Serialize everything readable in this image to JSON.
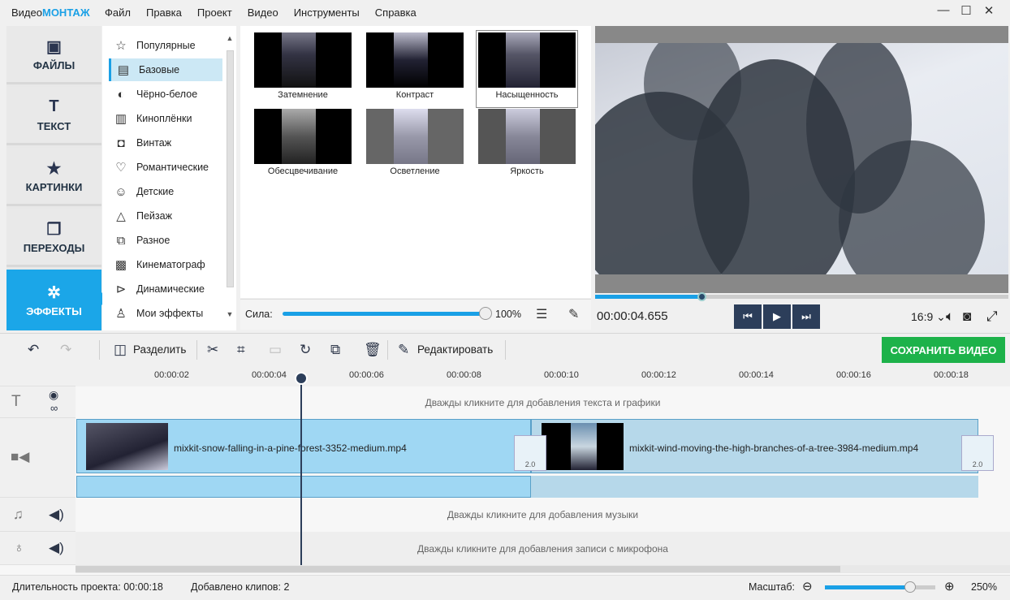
{
  "app": {
    "title_prefix": "Видео",
    "title_brand": "МОНТАЖ"
  },
  "menu": [
    "Файл",
    "Правка",
    "Проект",
    "Видео",
    "Инструменты",
    "Справка"
  ],
  "window_controls": {
    "minimize": "—",
    "maximize": "☐",
    "close": "✕"
  },
  "left_tabs": [
    {
      "label": "ФАЙЛЫ",
      "icon": "image-icon"
    },
    {
      "label": "ТЕКСТ",
      "icon": "text-t-icon"
    },
    {
      "label": "КАРТИНКИ",
      "icon": "star-icon"
    },
    {
      "label": "ПЕРЕХОДЫ",
      "icon": "transitions-icon"
    },
    {
      "label": "ЭФФЕКТЫ",
      "icon": "magic-wand-icon",
      "active": true
    }
  ],
  "categories": [
    {
      "label": "Популярные",
      "icon": "star-outline-icon"
    },
    {
      "label": "Базовые",
      "icon": "basic-icon",
      "selected": true
    },
    {
      "label": "Чёрно-белое",
      "icon": "bw-icon"
    },
    {
      "label": "Киноплёнки",
      "icon": "film-icon"
    },
    {
      "label": "Винтаж",
      "icon": "camera-icon"
    },
    {
      "label": "Романтические",
      "icon": "heart-icon"
    },
    {
      "label": "Детские",
      "icon": "kids-icon"
    },
    {
      "label": "Пейзаж",
      "icon": "landscape-icon"
    },
    {
      "label": "Разное",
      "icon": "misc-icon"
    },
    {
      "label": "Кинематограф",
      "icon": "movie-camera-icon"
    },
    {
      "label": "Динамические",
      "icon": "play-circle-icon"
    },
    {
      "label": "Мои эффекты",
      "icon": "user-icon"
    }
  ],
  "effects": [
    {
      "label": "Затемнение"
    },
    {
      "label": "Контраст"
    },
    {
      "label": "Насыщенность",
      "selected": true
    },
    {
      "label": "Обесцвечивание"
    },
    {
      "label": "Осветление"
    },
    {
      "label": "Яркость"
    }
  ],
  "strength": {
    "label": "Сила:",
    "value_text": "100%",
    "value": 1.0
  },
  "player": {
    "timecode": "00:00:04.655",
    "ratio": "16:9 ⌄",
    "progress": 0.257
  },
  "toolbar": {
    "split": "Разделить",
    "edit": "Редактировать",
    "save": "СОХРАНИТЬ ВИДЕО"
  },
  "ruler": [
    "00:00:02",
    "00:00:04",
    "00:00:06",
    "00:00:08",
    "00:00:10",
    "00:00:12",
    "00:00:14",
    "00:00:16",
    "00:00:18"
  ],
  "tracks": {
    "text_hint": "Дважды кликните для добавления текста и графики",
    "music_hint": "Дважды кликните для добавления музыки",
    "mic_hint": "Дважды кликните для добавления записи с микрофона"
  },
  "clips": [
    {
      "name": "mixkit-snow-falling-in-a-pine-forest-3352-medium.mp4",
      "transition": "2.0"
    },
    {
      "name": "mixkit-wind-moving-the-high-branches-of-a-tree-3984-medium.mp4",
      "transition": "2.0"
    }
  ],
  "status": {
    "duration": "Длительность проекта:  00:00:18",
    "clips": "Добавлено клипов: 2",
    "zoom_label": "Масштаб:",
    "zoom_value": "250%"
  },
  "colors": {
    "accent": "#1aa0e6",
    "save": "#1db24a",
    "dark": "#2c3e5a"
  }
}
